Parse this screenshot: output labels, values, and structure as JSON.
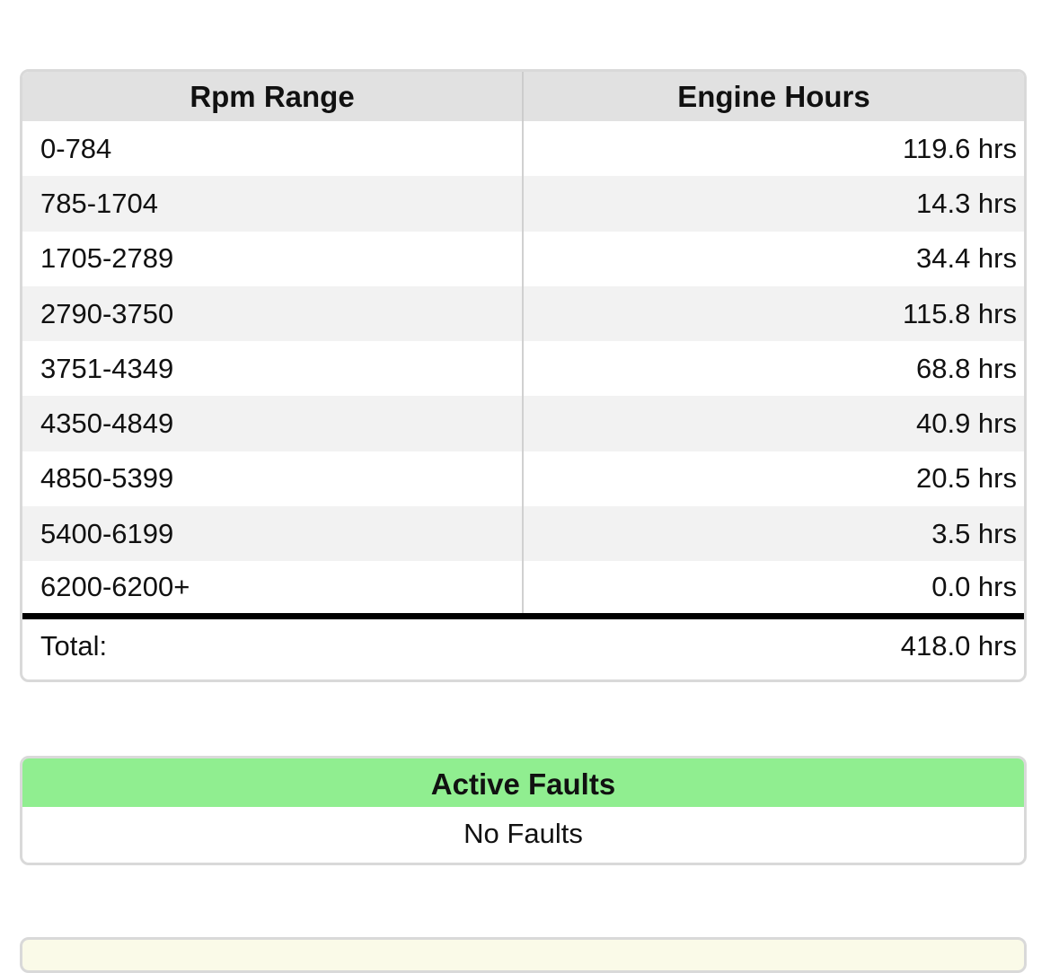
{
  "rpm_table": {
    "headers": {
      "range": "Rpm Range",
      "hours": "Engine Hours"
    },
    "rows": [
      {
        "range": "0-784",
        "hours": "119.6 hrs"
      },
      {
        "range": "785-1704",
        "hours": "14.3 hrs"
      },
      {
        "range": "1705-2789",
        "hours": "34.4 hrs"
      },
      {
        "range": "2790-3750",
        "hours": "115.8 hrs"
      },
      {
        "range": "3751-4349",
        "hours": "68.8 hrs"
      },
      {
        "range": "4350-4849",
        "hours": "40.9 hrs"
      },
      {
        "range": "4850-5399",
        "hours": "20.5 hrs"
      },
      {
        "range": "5400-6199",
        "hours": "3.5 hrs"
      },
      {
        "range": "6200-6200+",
        "hours": "0.0 hrs"
      }
    ],
    "total": {
      "label": "Total:",
      "hours": "418.0 hrs"
    }
  },
  "faults": {
    "title": "Active Faults",
    "status": "No Faults"
  },
  "colors": {
    "faults_header": "#90ee90",
    "table_header": "#e1e1e1",
    "alt_row": "#f2f2f2"
  }
}
